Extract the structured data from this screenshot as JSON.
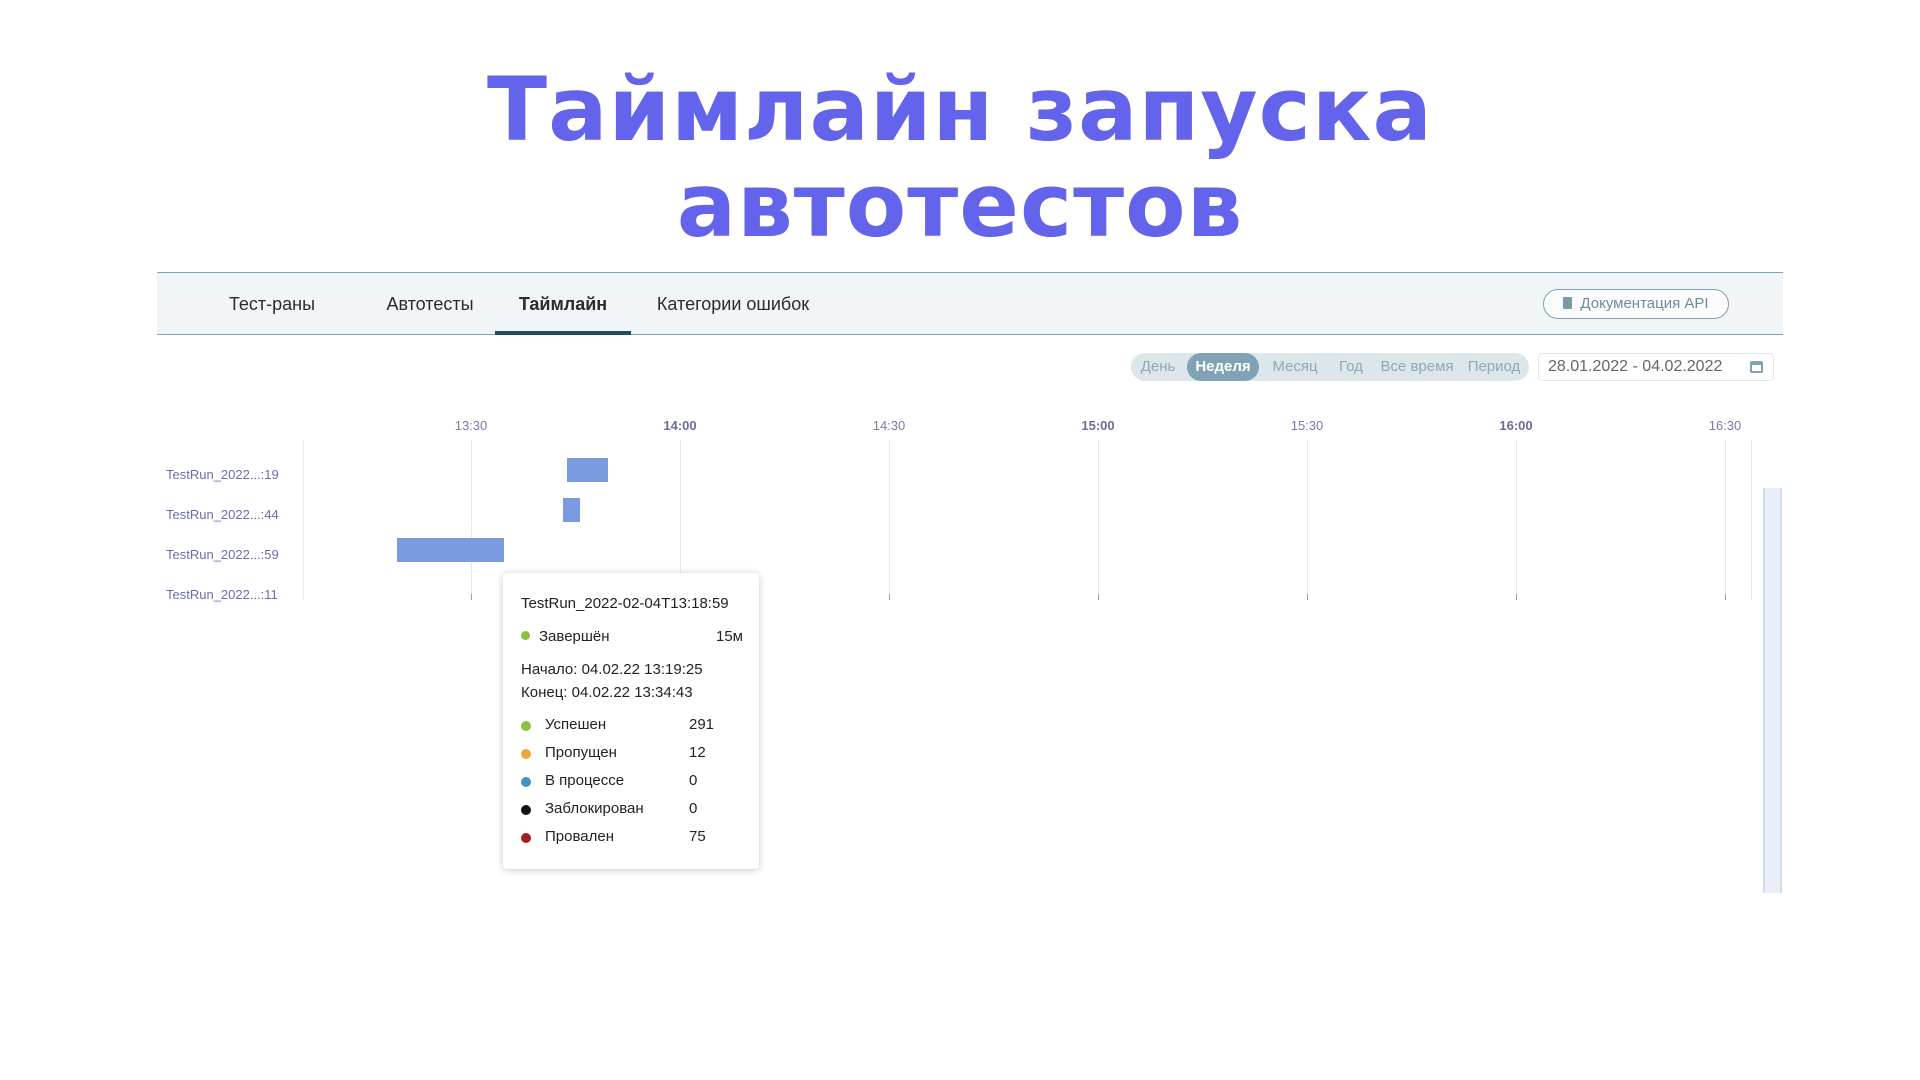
{
  "title": {
    "line1": "Таймлайн запуска",
    "line2": "автотестов"
  },
  "nav": {
    "tabs": [
      {
        "label": "Тест-раны",
        "active": false
      },
      {
        "label": "Автотесты",
        "active": false
      },
      {
        "label": "Таймлайн",
        "active": true
      },
      {
        "label": "Категории ошибок",
        "active": false
      }
    ],
    "api_button": "Документация API"
  },
  "period": {
    "options": [
      "День",
      "Неделя",
      "Месяц",
      "Год",
      "Все время",
      "Период"
    ],
    "selected": "Неделя",
    "date_range": "28.01.2022 - 04.02.2022"
  },
  "timeline": {
    "ticks": [
      {
        "label": "13:30",
        "major": false
      },
      {
        "label": "14:00",
        "major": true
      },
      {
        "label": "14:30",
        "major": false
      },
      {
        "label": "15:00",
        "major": true
      },
      {
        "label": "15:30",
        "major": false
      },
      {
        "label": "16:00",
        "major": true
      },
      {
        "label": "16:30",
        "major": false
      }
    ],
    "rows": [
      {
        "label": "TestRun_2022...:19",
        "start": "13:43",
        "end": "13:49"
      },
      {
        "label": "TestRun_2022...:44",
        "start": "13:42",
        "end": "13:44"
      },
      {
        "label": "TestRun_2022...:59",
        "start": "13:19:25",
        "end": "13:34:43"
      },
      {
        "label": "TestRun_2022...:11",
        "start": null,
        "end": null
      }
    ],
    "bar_color": "#7b9be0"
  },
  "tooltip": {
    "title": "TestRun_2022-02-04T13:18:59",
    "status": "Завершён",
    "duration": "15м",
    "start": "Начало: 04.02.22 13:19:25",
    "end": "Конец: 04.02.22 13:34:43",
    "stats": [
      {
        "label": "Успешен",
        "value": "291",
        "color": "#8cc13c"
      },
      {
        "label": "Пропущен",
        "value": "12",
        "color": "#f0a53c"
      },
      {
        "label": "В процессе",
        "value": "0",
        "color": "#3f93c4"
      },
      {
        "label": "Заблокирован",
        "value": "0",
        "color": "#111111"
      },
      {
        "label": "Провален",
        "value": "75",
        "color": "#a31e1e"
      }
    ]
  },
  "colors": {
    "accent": "#6463ec",
    "nav_underline": "#1f4c5e",
    "period_active": "#7fa3b5"
  }
}
